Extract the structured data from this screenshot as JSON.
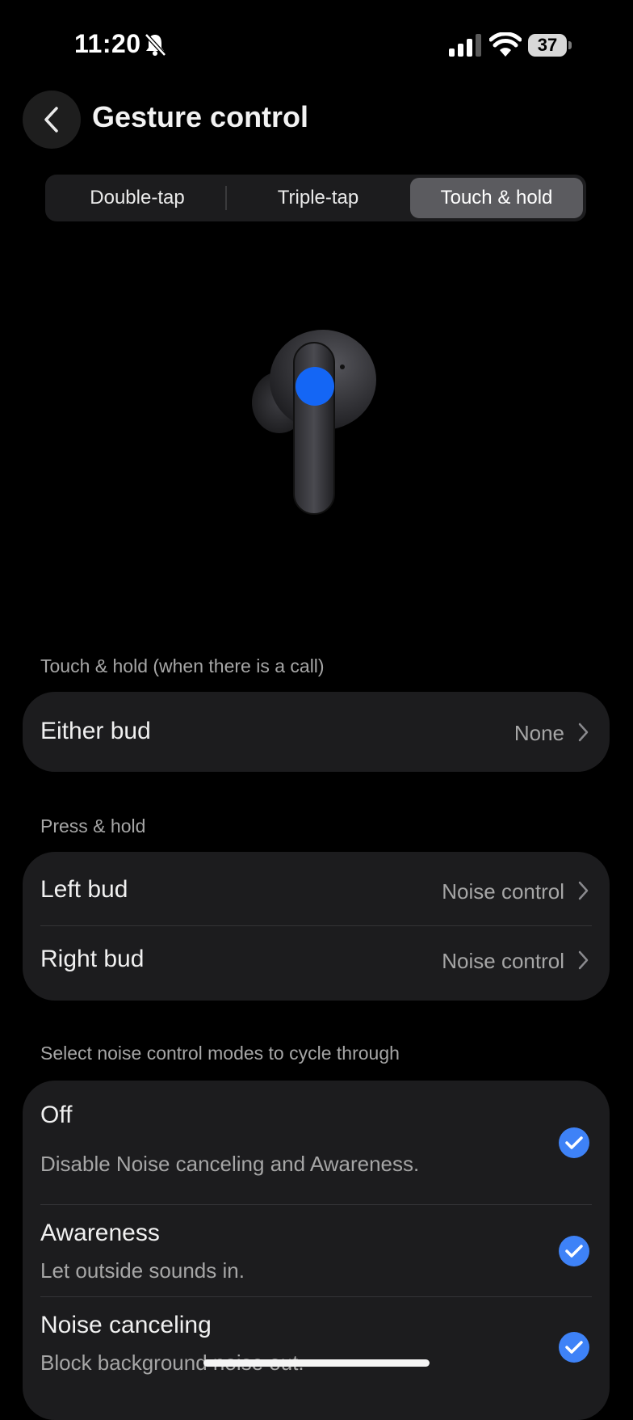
{
  "status_bar": {
    "time": "11:20",
    "battery": "37",
    "icons": [
      "bell-muted-icon",
      "signal-icon",
      "wifi-icon",
      "battery-icon"
    ]
  },
  "header": {
    "title": "Gesture control",
    "back_icon": "chevron-left-icon"
  },
  "tabs": [
    {
      "label": "Double-tap",
      "selected": false
    },
    {
      "label": "Triple-tap",
      "selected": false
    },
    {
      "label": "Touch & hold",
      "selected": true
    }
  ],
  "illustration": {
    "name": "earbud-icon",
    "highlight_color": "#1466f5"
  },
  "call_section": {
    "label": "Touch & hold (when there is a call)",
    "rows": [
      {
        "label": "Either bud",
        "value": "None"
      }
    ]
  },
  "press_section": {
    "label": "Press & hold",
    "rows": [
      {
        "label": "Left bud",
        "value": "Noise control"
      },
      {
        "label": "Right bud",
        "value": "Noise control"
      }
    ]
  },
  "modes_section": {
    "label": "Select noise control modes to cycle through",
    "modes": [
      {
        "title": "Off",
        "description": "Disable Noise canceling and Awareness.",
        "checked": true
      },
      {
        "title": "Awareness",
        "description": "Let outside sounds in.",
        "checked": true
      },
      {
        "title": "Noise canceling",
        "description": "Block background noise out.",
        "checked": true
      }
    ]
  },
  "colors": {
    "background": "#000000",
    "card": "#1c1c1e",
    "accent": "#3e82f7",
    "selected_tab": "#5b5b5f"
  }
}
